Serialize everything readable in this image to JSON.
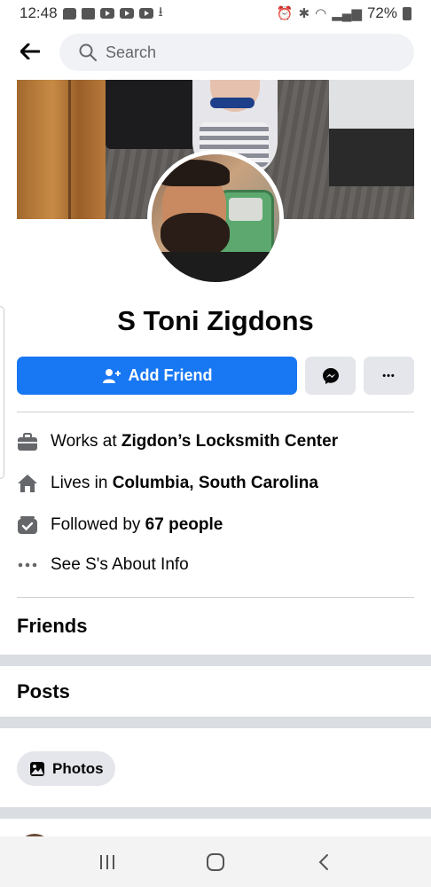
{
  "status_bar": {
    "time": "12:48",
    "battery": "72%"
  },
  "search": {
    "placeholder": "Search"
  },
  "profile": {
    "name": "S Toni Zigdons",
    "add_friend_label": "Add Friend",
    "more_label": "•••"
  },
  "info": {
    "work_prefix": "Works at ",
    "work_place": "Zigdon’s Locksmith Center",
    "lives_prefix": "Lives in ",
    "lives_place": "Columbia, South Carolina",
    "followed_prefix": "Followed by ",
    "followed_count": "67 people",
    "about_label": "See S's About Info"
  },
  "sections": {
    "friends": "Friends",
    "posts": "Posts",
    "photos": "Photos"
  },
  "colors": {
    "accent": "#1877f2",
    "button_gray": "#e4e6eb",
    "band_gray": "#dadde1"
  },
  "icons": [
    "back-arrow-icon",
    "search-icon",
    "add-person-icon",
    "messenger-icon",
    "more-icon",
    "briefcase-icon",
    "home-icon",
    "followers-icon",
    "ellipsis-icon",
    "photos-icon",
    "recent-apps-icon",
    "home-nav-icon",
    "back-nav-icon"
  ]
}
